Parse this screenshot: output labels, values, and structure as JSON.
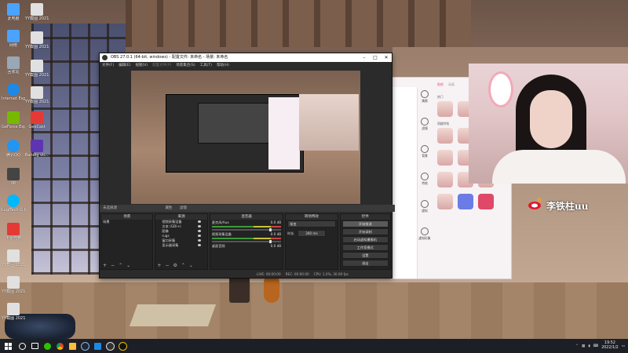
{
  "desktop": {
    "icons": [
      {
        "label": "此电脑",
        "color": "#4aa3ff"
      },
      {
        "label": "网络",
        "color": "#4aa3ff"
      },
      {
        "label": "回收站",
        "color": "#9aa7b5"
      },
      {
        "label": "Internet Explorer",
        "color": "#1e88e5"
      },
      {
        "label": "GeForce Experience",
        "color": "#76b900"
      },
      {
        "label": "腾讯QQ",
        "color": "#2196f3"
      },
      {
        "label": "06",
        "color": "#444444"
      },
      {
        "label": "LogiTech G HUB",
        "color": "#00b8fc"
      },
      {
        "label": "卡祝元斐",
        "color": "#e53935"
      },
      {
        "label": "YY截图 20211005",
        "color": "#e0e0e0"
      },
      {
        "label": "YY截图 20211005",
        "color": "#e0e0e0"
      },
      {
        "label": "YY截图 20211020",
        "color": "#e0e0e0"
      }
    ],
    "icons_col2": [
      {
        "label": "YY截图 20211005",
        "color": "#e0e0e0"
      },
      {
        "label": "YY截图 20211005",
        "color": "#e0e0e0"
      },
      {
        "label": "YY截图 20211005",
        "color": "#e0e0e0"
      },
      {
        "label": "YY截图 20211020",
        "color": "#e0e0e0"
      },
      {
        "label": "GeeCast",
        "color": "#e53935"
      },
      {
        "label": "Bandig vic...",
        "color": "#5e35b1"
      }
    ]
  },
  "obs": {
    "title": "OBS 27.0.1 (64-bit, windows) - 配置文件: 未命名 - 场景: 未命名",
    "menu": [
      "文件(F)",
      "编辑(E)",
      "视图(V)",
      "配置文件(P)",
      "场景集合(S)",
      "工具(T)",
      "帮助(H)"
    ],
    "status_label": "未选择源",
    "status_props": "属性",
    "status_filters": "滤镜",
    "docks": {
      "scenes": {
        "header": "场景",
        "items": [
          "场景"
        ]
      },
      "sources": {
        "header": "来源",
        "items": [
          "视频采集设备",
          "文本 (GDI+)",
          "图像",
          "rugs",
          "窗口采集",
          "显示器采集"
        ]
      },
      "mixer": {
        "header": "混音器",
        "channels": [
          {
            "name": "麦克风/Aux",
            "db": "0.0 dB"
          },
          {
            "name": "视频采集设备",
            "db": "0.0 dB"
          },
          {
            "name": "桌面音频",
            "db": "0.0 dB"
          }
        ]
      },
      "transitions": {
        "header": "转场特效",
        "type": "渐变",
        "duration_label": "时长",
        "duration": "300 ms"
      },
      "controls": {
        "header": "控件",
        "buttons": [
          "开始推流",
          "开始录制",
          "启动虚拟摄像机",
          "工作室模式",
          "设置",
          "退出"
        ]
      }
    },
    "footer": {
      "live": "LIVE: 00:00:00",
      "rec": "REC: 00:00:00",
      "cpu": "CPU: 1.0%, 30.00 fps"
    }
  },
  "live_panel": {
    "tabs": [
      "贴纸",
      "动画"
    ],
    "nav": [
      "美颜",
      "滤镜",
      "背景",
      "特效",
      "虚拟",
      "虚拟形象"
    ],
    "section_labels": [
      "热门",
      "萌趣特效"
    ]
  },
  "webcam": {
    "watermark": "李铁柱uu"
  },
  "taskbar": {
    "time": "19:52",
    "date": "2022/1/2"
  }
}
